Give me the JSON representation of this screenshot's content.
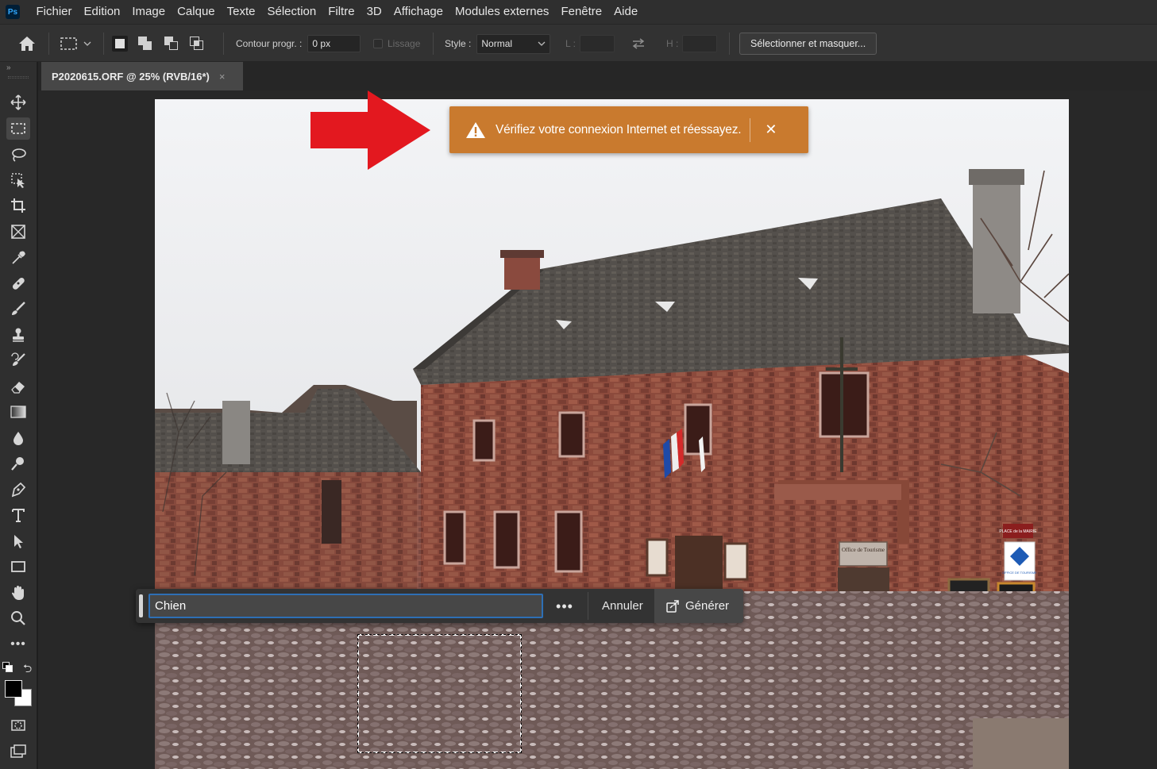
{
  "app": {
    "logo_text": "Ps"
  },
  "menu": [
    "Fichier",
    "Edition",
    "Image",
    "Calque",
    "Texte",
    "Sélection",
    "Filtre",
    "3D",
    "Affichage",
    "Modules externes",
    "Fenêtre",
    "Aide"
  ],
  "options": {
    "feather_label": "Contour progr. :",
    "feather_value": "0 px",
    "antialias_label": "Lissage",
    "style_label": "Style :",
    "style_value": "Normal",
    "width_label": "L :",
    "height_label": "H :",
    "select_mask_label": "Sélectionner et masquer..."
  },
  "document": {
    "tab_title": "P2020615.ORF @ 25% (RVB/16*)",
    "tab_close": "×"
  },
  "notification": {
    "message": "Vérifiez votre connexion Internet et réessayez.",
    "close": "✕",
    "bg_color": "#c97a2e"
  },
  "generative_fill": {
    "prompt_value": "Chien",
    "more_label": "•••",
    "cancel_label": "Annuler",
    "generate_label": "Générer"
  },
  "photo_signs": {
    "office_sign": "Office de Tourisme",
    "place_sign": "PLACE de la MAIRIE",
    "ot_sign": "OFFICE DE TOURISME"
  }
}
